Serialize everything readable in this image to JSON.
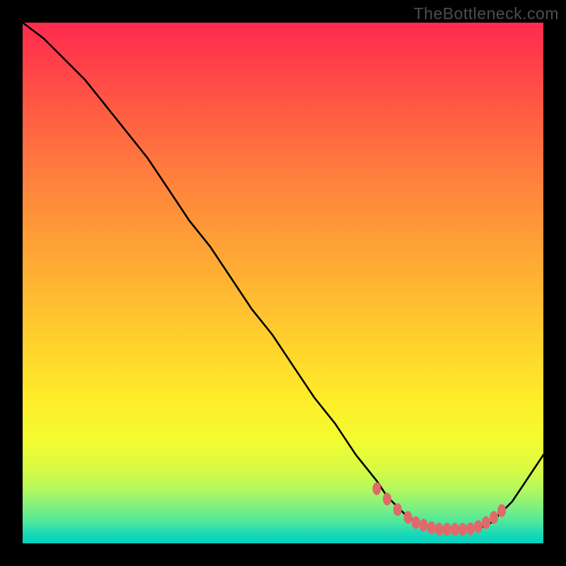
{
  "watermark": "TheBottleneck.com",
  "chart_data": {
    "type": "line",
    "title": "",
    "xlabel": "",
    "ylabel": "",
    "xlim": [
      0,
      100
    ],
    "ylim": [
      0,
      100
    ],
    "series": [
      {
        "name": "bottleneck-curve",
        "x": [
          0,
          4,
          8,
          12,
          16,
          20,
          24,
          28,
          32,
          36,
          40,
          44,
          48,
          52,
          56,
          60,
          64,
          68,
          70,
          72,
          74,
          76,
          78,
          80,
          82,
          84,
          86,
          88,
          90,
          92,
          94,
          96,
          98,
          100
        ],
        "values": [
          100,
          97,
          93,
          89,
          84,
          79,
          74,
          68,
          62,
          57,
          51,
          45,
          40,
          34,
          28,
          23,
          17,
          12,
          9,
          7,
          5,
          4,
          3,
          2.5,
          2.5,
          2.5,
          2.5,
          3,
          4,
          6,
          8,
          11,
          14,
          17
        ]
      }
    ],
    "markers": {
      "name": "optimal-zone-dots",
      "color": "#e06a6a",
      "points_x": [
        68,
        70,
        72,
        74,
        75.5,
        77,
        78.5,
        80,
        81.5,
        83,
        84.5,
        86,
        87.5,
        89,
        90.5,
        92
      ],
      "points_y": [
        10.5,
        8.5,
        6.5,
        5,
        4,
        3.5,
        3,
        2.7,
        2.7,
        2.7,
        2.7,
        2.8,
        3.2,
        4,
        5,
        6.3
      ]
    },
    "gradient_stops": [
      {
        "pos": 0,
        "color": "#ff2b4f"
      },
      {
        "pos": 16,
        "color": "#ff5944"
      },
      {
        "pos": 40,
        "color": "#ff9a38"
      },
      {
        "pos": 63,
        "color": "#ffd52c"
      },
      {
        "pos": 80,
        "color": "#f4fb31"
      },
      {
        "pos": 93,
        "color": "#7ff080"
      },
      {
        "pos": 100,
        "color": "#04d0c0"
      }
    ]
  }
}
